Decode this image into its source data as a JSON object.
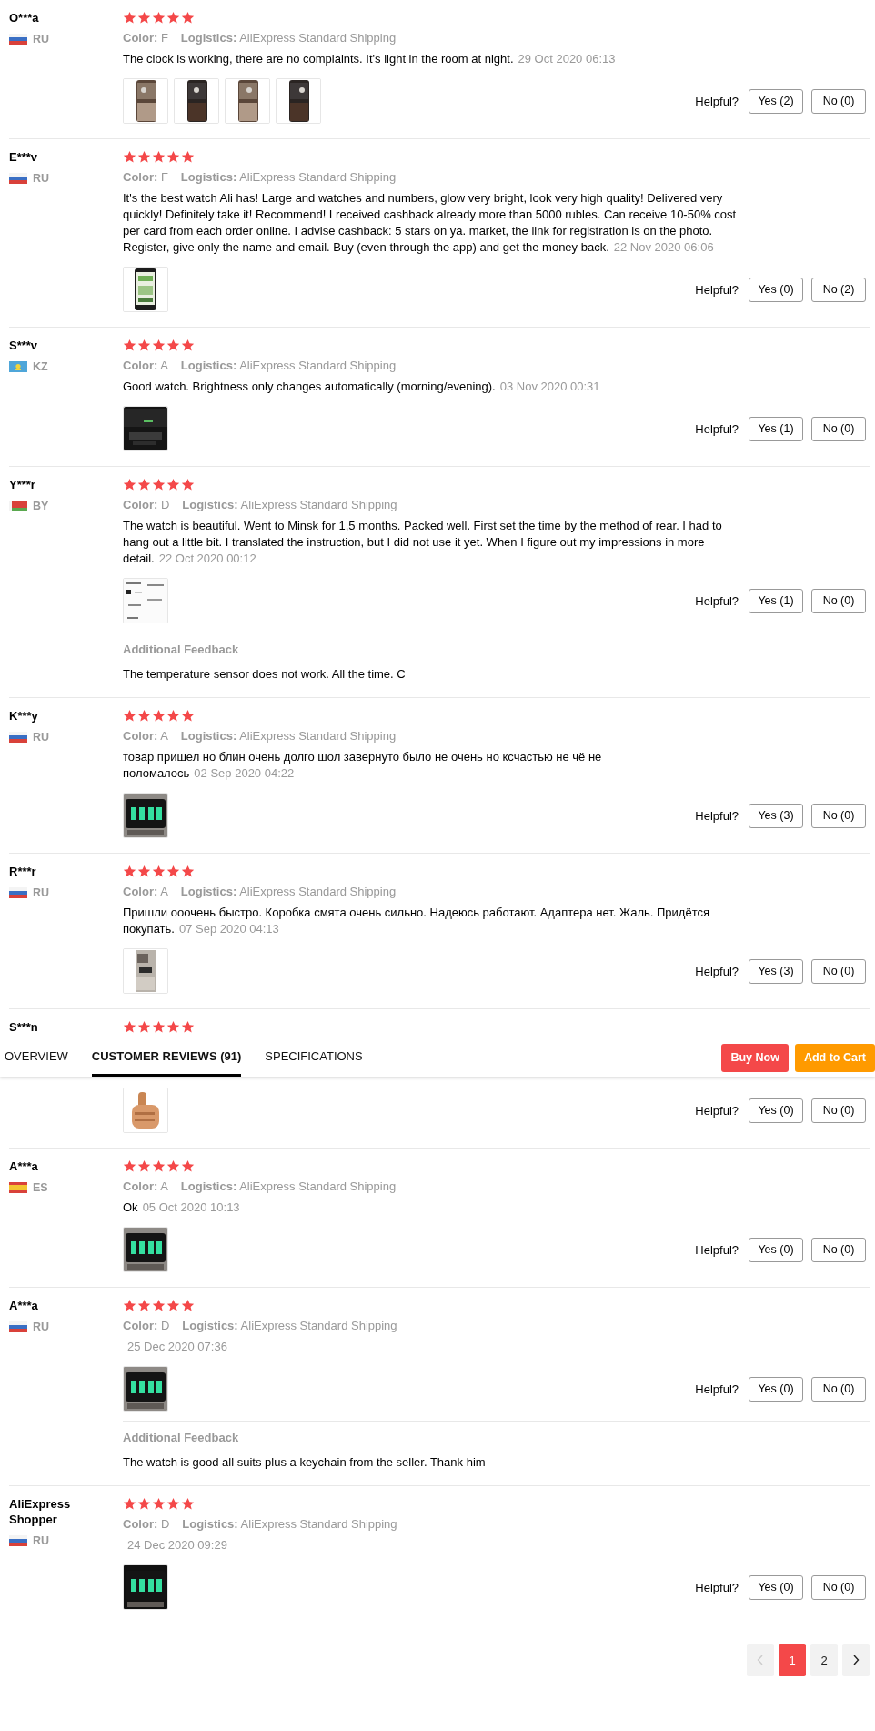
{
  "reviews": [
    {
      "name": "O***a",
      "flag": {
        "kind": "ru"
      },
      "country": "RU",
      "stars": 5,
      "variant": "**Color:** F",
      "shipping": "**Logistics:** AliExpress Standard Shipping",
      "text": "The clock is working, there are no complaints. It's light in the room at night.",
      "date": "29 Oct 2020 06:13",
      "photos": [
        {
          "kind": "picture"
        },
        {
          "kind": "picture"
        },
        {
          "kind": "picture"
        },
        {
          "kind": "picture"
        }
      ],
      "helpful_label": "Helpful?",
      "yes": "Yes (2)",
      "no": "No (0)"
    },
    {
      "name": "E***v",
      "flag": {
        "kind": "ru"
      },
      "country": "RU",
      "stars": 5,
      "variant": "**Color:** F",
      "shipping": "**Logistics:** AliExpress Standard Shipping",
      "text": "It's the best watch Ali has! Large and watches and numbers, glow very bright, look very high quality! Delivered very quickly! Definitely take it! Recommend! I received cashback already more than 5000 rubles. Can receive 10-50% cost per card from each order online. I advise cashback: 5 stars on ya. market, the link for registration is on the photo. Register, give only the name and email. Buy (even through the app) and get the money back.",
      "date": "22 Nov 2020 06:06",
      "photos": [
        {
          "kind": "picture"
        }
      ],
      "helpful_label": "Helpful?",
      "yes": "Yes (0)",
      "no": "No (2)"
    },
    {
      "name": "S***v",
      "flag": {
        "kind": "kz"
      },
      "country": "KZ",
      "stars": 5,
      "variant": "**Color:** A",
      "shipping": "**Logistics:** AliExpress Standard Shipping",
      "text": "Good watch. Brightness only changes automatically (morning/evening).",
      "date": "03 Nov 2020 00:31",
      "photos": [
        {
          "kind": "picture"
        }
      ],
      "helpful_label": "Helpful?",
      "yes": "Yes (1)",
      "no": "No (0)"
    },
    {
      "name": "Y***r",
      "flag": {
        "kind": "by"
      },
      "country": "BY",
      "stars": 5,
      "variant": "**Color:** D",
      "shipping": "**Logistics:** AliExpress Standard Shipping",
      "text": "The watch is beautiful. Went to Minsk for 1,5 months. Packed well. First set the time by the method of rear. I had to hang out a little bit. I translated the instruction, but I did not use it yet. When I figure out my impressions in more detail.",
      "date": "22 Oct 2020 00:12",
      "photos": [
        {
          "kind": "picture"
        }
      ],
      "helpful_label": "Helpful?",
      "yes": "Yes (1)",
      "no": "No (0)",
      "additional": {
        "label": "Additional Feedback",
        "text": "The temperature sensor does not work. All the time. C"
      }
    },
    {
      "name": "K***y",
      "flag": {
        "kind": "ru"
      },
      "country": "RU",
      "stars": 5,
      "variant": "**Color:** A",
      "shipping": "**Logistics:** AliExpress Standard Shipping",
      "text": "товар пришел но блин очень долго шол завернуто было не очень но ксчастью не чё не поломалось",
      "date": "02 Sep 2020 04:22",
      "photos": [
        {
          "kind": "picture"
        }
      ],
      "helpful_label": "Helpful?",
      "yes": "Yes (3)",
      "no": "No (0)"
    },
    {
      "name": "R***r",
      "flag": {
        "kind": "ru"
      },
      "country": "RU",
      "stars": 5,
      "variant": "**Color:** A",
      "shipping": "**Logistics:** AliExpress Standard Shipping",
      "text": "Пришли ооочень быстро. Коробка смята очень сильно. Надеюсь работают. Адаптера нет. Жаль. Придётся покупать.",
      "date": "07 Sep 2020 04:13",
      "photos": [
        {
          "kind": "picture"
        }
      ],
      "helpful_label": "Helpful?",
      "yes": "Yes (3)",
      "no": "No (0)"
    },
    {
      "name": "S***n",
      "stars": 5,
      "overlay_nav": {
        "tabs": [
          {
            "label": "OVERVIEW",
            "selected": false
          },
          {
            "label": "CUSTOMER REVIEWS (91)",
            "selected": true
          },
          {
            "label": "SPECIFICATIONS",
            "selected": false
          }
        ],
        "buy": "Buy Now",
        "cart": "Add to Cart"
      },
      "photos": [
        {
          "kind": "picture"
        }
      ],
      "helpful_label": "Helpful?",
      "yes": "Yes (0)",
      "no": "No (0)"
    },
    {
      "name": "A***a",
      "flag": {
        "kind": "es"
      },
      "country": "ES",
      "stars": 5,
      "variant": "**Color:** A",
      "shipping": "**Logistics:** AliExpress Standard Shipping",
      "text": "Ok",
      "date": "05 Oct 2020 10:13",
      "photos": [
        {
          "kind": "picture"
        }
      ],
      "helpful_label": "Helpful?",
      "yes": "Yes (0)",
      "no": "No (0)"
    },
    {
      "name": "A***a",
      "flag": {
        "kind": "ru"
      },
      "country": "RU",
      "stars": 5,
      "variant": "**Color:** D",
      "shipping": "**Logistics:** AliExpress Standard Shipping",
      "date": "25 Dec 2020 07:36",
      "photos": [
        {
          "kind": "picture"
        }
      ],
      "helpful_label": "Helpful?",
      "yes": "Yes (0)",
      "no": "No (0)",
      "additional": {
        "label": "Additional Feedback",
        "text": "The watch is good all suits plus a keychain from the seller. Thank him"
      }
    },
    {
      "name": "AliExpress Shopper",
      "flag": {
        "kind": "ru"
      },
      "country": "RU",
      "stars": 5,
      "variant": "**Color:** D",
      "shipping": "**Logistics:** AliExpress Standard Shipping",
      "date": "24 Dec 2020 09:29",
      "photos": [
        {
          "kind": "picture"
        }
      ],
      "helpful_label": "Helpful?",
      "yes": "Yes (0)",
      "no": "No (0)"
    }
  ],
  "pagination": {
    "prev_disabled": true,
    "pages": [
      {
        "label": "1",
        "selected": true
      },
      {
        "label": "2",
        "selected": false
      }
    ],
    "next_disabled": false
  }
}
